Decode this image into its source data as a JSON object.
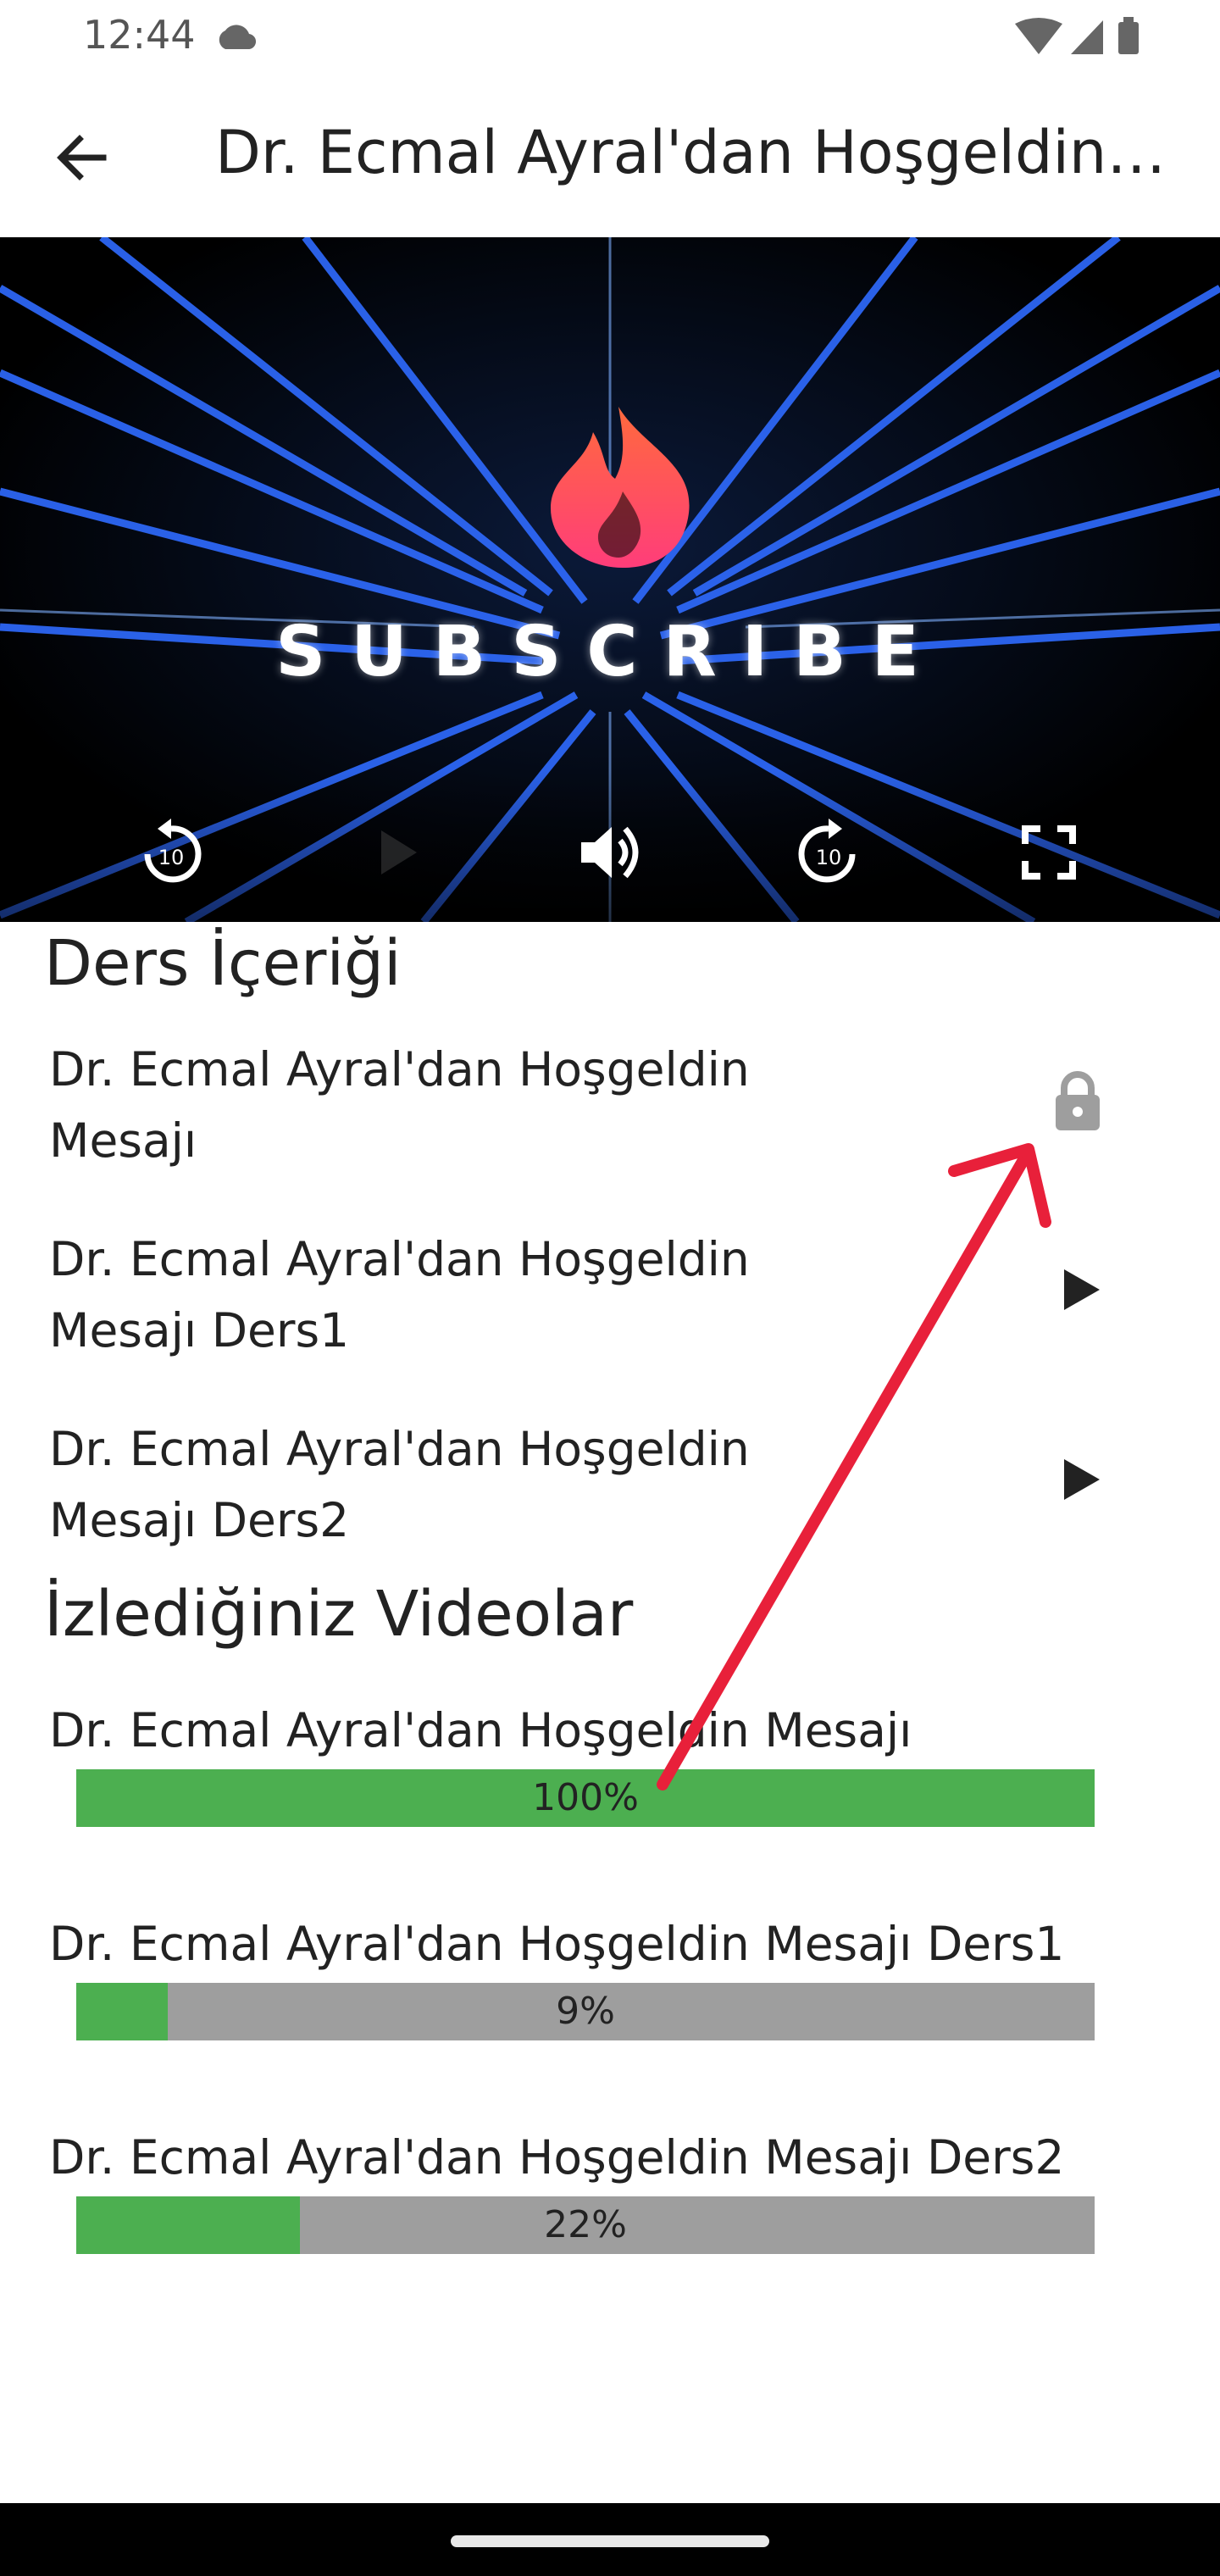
{
  "status_bar": {
    "time": "12:44"
  },
  "app_bar": {
    "title": "Dr. Ecmal Ayral'dan Hoşgeldin Mesajı"
  },
  "video": {
    "overlay_text": "SUBSCRIBE",
    "controls": [
      "replay-10-icon",
      "play-icon",
      "volume-icon",
      "forward-10-icon",
      "fullscreen-icon"
    ],
    "skip_label": "10"
  },
  "course_content": {
    "title": "Ders İçeriği",
    "lessons": [
      {
        "title": "Dr. Ecmal Ayral'dan Hoşgeldin Mesajı",
        "icon": "lock-icon"
      },
      {
        "title": "Dr. Ecmal Ayral'dan Hoşgeldin Mesajı Ders1",
        "icon": "play-icon"
      },
      {
        "title": "Dr. Ecmal Ayral'dan Hoşgeldin Mesajı Ders2",
        "icon": "play-icon"
      }
    ]
  },
  "watched": {
    "title": "İzlediğiniz Videolar",
    "items": [
      {
        "title": "Dr. Ecmal Ayral'dan Hoşgeldin Mesajı",
        "progress_label": "100%",
        "progress": 100
      },
      {
        "title": "Dr. Ecmal Ayral'dan Hoşgeldin Mesajı Ders1",
        "progress_label": "9%",
        "progress": 9
      },
      {
        "title": "Dr. Ecmal Ayral'dan Hoşgeldin Mesajı Ders2",
        "progress_label": "22%",
        "progress": 22
      }
    ]
  },
  "colors": {
    "progress_fill": "#4caf50",
    "progress_track": "#9e9e9e",
    "annotation_arrow": "#e8203a",
    "lock_icon": "#9e9e9e"
  }
}
